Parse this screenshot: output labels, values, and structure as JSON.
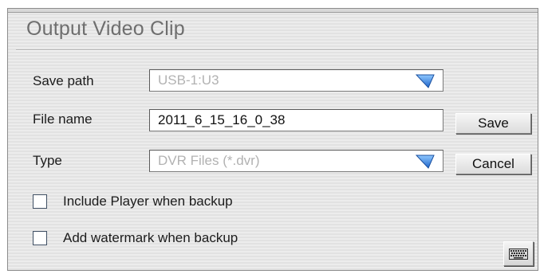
{
  "dialog": {
    "title": "Output Video Clip"
  },
  "save_path": {
    "label": "Save path",
    "value": "USB-1:U3",
    "icon": "dropdown-arrow-icon"
  },
  "file_name": {
    "label": "File name",
    "value": "2011_6_15_16_0_38"
  },
  "type": {
    "label": "Type",
    "value": "DVR Files (*.dvr)",
    "icon": "dropdown-arrow-icon"
  },
  "buttons": {
    "save_label": "Save",
    "cancel_label": "Cancel"
  },
  "options": [
    {
      "label": "Include Player when backup",
      "checked": false
    },
    {
      "label": "Add watermark when backup",
      "checked": false
    }
  ],
  "keyboard": {
    "icon": "keyboard-icon"
  },
  "colors": {
    "dropdown_arrow": "#2f7fe0",
    "title_text": "#6e6e6e",
    "disabled_text": "#b2b2b2"
  }
}
